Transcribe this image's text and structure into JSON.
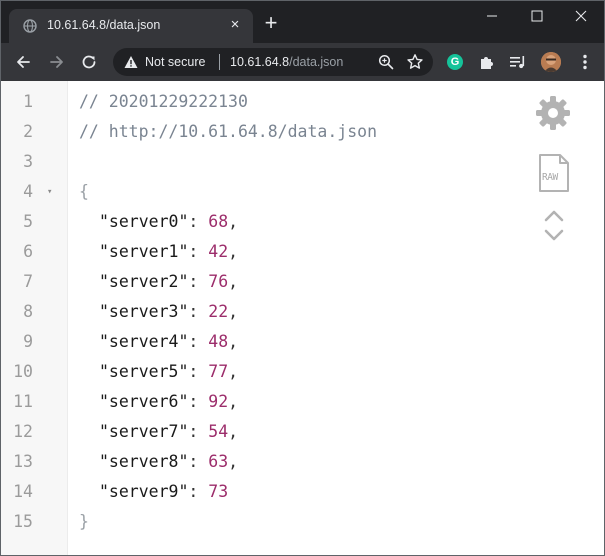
{
  "tab": {
    "title": "10.61.64.8/data.json",
    "close_glyph": "×",
    "new_tab_glyph": "+"
  },
  "omnibox": {
    "security_label": "Not secure",
    "url_host": "10.61.64.8",
    "url_path": "/data.json"
  },
  "extensions": {
    "grammarly_letter": "G"
  },
  "icons": {
    "favicon": "globe-icon",
    "back": "arrow-left-icon",
    "forward": "arrow-right-icon",
    "reload": "reload-icon",
    "warning": "warning-icon",
    "zoom": "zoom-icon",
    "bookmark": "star-icon",
    "extensions": "puzzle-icon",
    "media": "playlist-icon",
    "menu": "kebab-menu-icon",
    "settings": "gear-icon",
    "raw": "raw-file-icon"
  },
  "viewer": {
    "raw_label": "RAW",
    "lines": [
      {
        "n": "1",
        "kind": "comment",
        "text": "// 20201229222130"
      },
      {
        "n": "2",
        "kind": "comment",
        "text": "// http://10.61.64.8/data.json"
      },
      {
        "n": "3",
        "kind": "blank"
      },
      {
        "n": "4",
        "kind": "open",
        "text": "{",
        "fold": "▾"
      },
      {
        "n": "5",
        "kind": "pair",
        "key": "\"server0\"",
        "value": "68",
        "sep": ": ",
        "trail": ","
      },
      {
        "n": "6",
        "kind": "pair",
        "key": "\"server1\"",
        "value": "42",
        "sep": ": ",
        "trail": ","
      },
      {
        "n": "7",
        "kind": "pair",
        "key": "\"server2\"",
        "value": "76",
        "sep": ": ",
        "trail": ","
      },
      {
        "n": "8",
        "kind": "pair",
        "key": "\"server3\"",
        "value": "22",
        "sep": ": ",
        "trail": ","
      },
      {
        "n": "9",
        "kind": "pair",
        "key": "\"server4\"",
        "value": "48",
        "sep": ": ",
        "trail": ","
      },
      {
        "n": "10",
        "kind": "pair",
        "key": "\"server5\"",
        "value": "77",
        "sep": ": ",
        "trail": ","
      },
      {
        "n": "11",
        "kind": "pair",
        "key": "\"server6\"",
        "value": "92",
        "sep": ": ",
        "trail": ","
      },
      {
        "n": "12",
        "kind": "pair",
        "key": "\"server7\"",
        "value": "54",
        "sep": ": ",
        "trail": ","
      },
      {
        "n": "13",
        "kind": "pair",
        "key": "\"server8\"",
        "value": "63",
        "sep": ": ",
        "trail": ","
      },
      {
        "n": "14",
        "kind": "pair",
        "key": "\"server9\"",
        "value": "73",
        "sep": ": ",
        "trail": ""
      },
      {
        "n": "15",
        "kind": "close",
        "text": "}"
      }
    ]
  },
  "colors": {
    "titlebar": "#202124",
    "toolbar": "#35363a",
    "json_number": "#9c2d6b",
    "comment": "#7a8491",
    "grammarly": "#15c39a"
  }
}
